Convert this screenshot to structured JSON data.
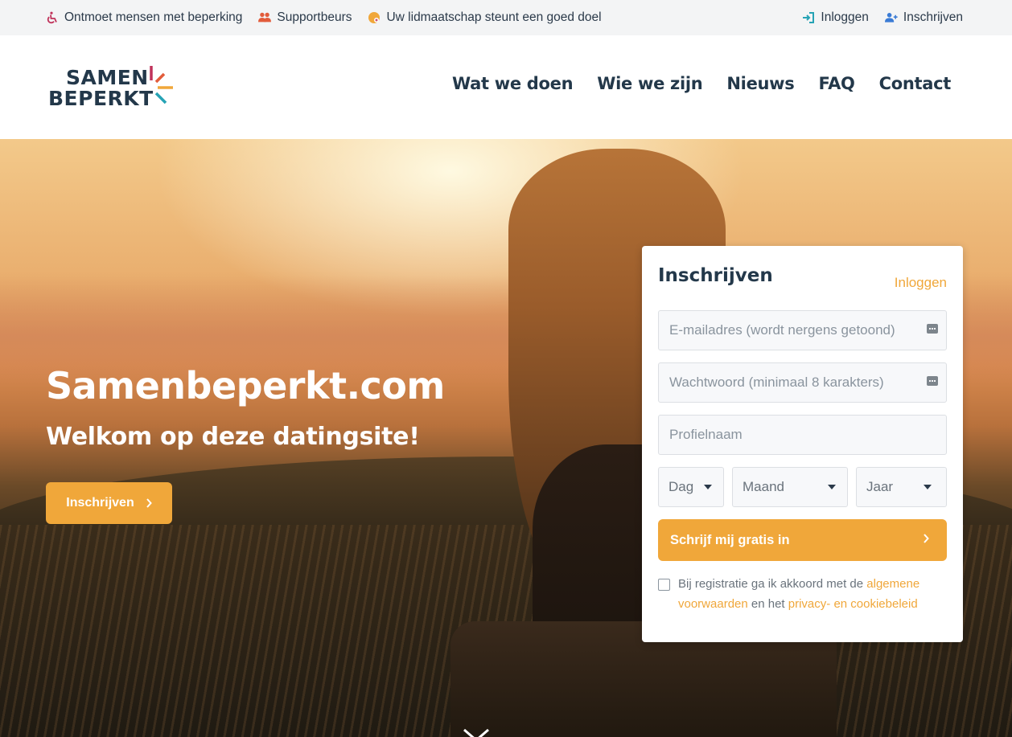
{
  "topbar": {
    "left": [
      {
        "label": "Ontmoet mensen met beperking",
        "icon": "wheelchair-icon",
        "color": "#c0325a"
      },
      {
        "label": "Supportbeurs",
        "icon": "users-icon",
        "color": "#e25c3b"
      },
      {
        "label": "Uw lidmaatschap steunt een goed doel",
        "icon": "donation-icon",
        "color": "#f0a73a"
      }
    ],
    "right": [
      {
        "label": "Inloggen",
        "icon": "sign-in-icon",
        "color": "#26a3b5"
      },
      {
        "label": "Inschrijven",
        "icon": "user-plus-icon",
        "color": "#3a7bd5"
      }
    ]
  },
  "logo": {
    "line1": "SAMEN",
    "line2": "BEPERKT"
  },
  "nav": [
    "Wat we doen",
    "Wie we zijn",
    "Nieuws",
    "FAQ",
    "Contact"
  ],
  "hero": {
    "title": "Samenbeperkt.com",
    "subtitle": "Welkom op deze datingsite!",
    "button": "Inschrijven"
  },
  "form": {
    "title": "Inschrijven",
    "login_link": "Inloggen",
    "email_placeholder": "E-mailadres (wordt nergens getoond)",
    "password_placeholder": "Wachtwoord (minimaal 8 karakters)",
    "profile_placeholder": "Profielnaam",
    "day": "Dag",
    "month": "Maand",
    "year": "Jaar",
    "submit": "Schrijf mij gratis in",
    "terms_prefix": "Bij registratie ga ik akkoord met de ",
    "terms_link1": "algemene voorwaarden",
    "terms_mid": " en het ",
    "terms_link2": "privacy- en cookiebeleid"
  },
  "colors": {
    "accent": "#f0a73a",
    "navy": "#23384a"
  }
}
